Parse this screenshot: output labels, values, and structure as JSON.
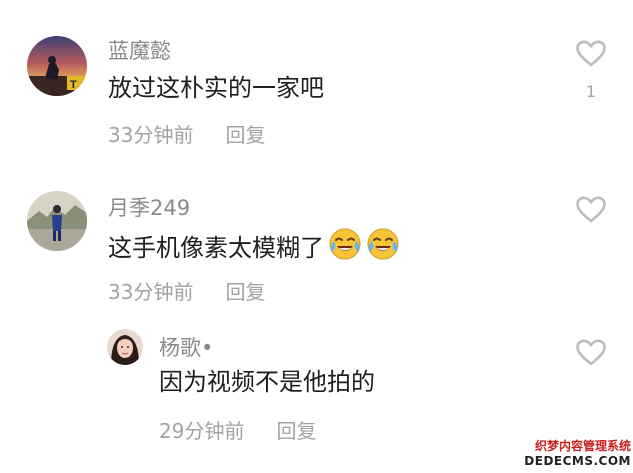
{
  "comments": [
    {
      "username": "蓝魔懿",
      "text": "放过这朴实的一家吧",
      "time": "33分钟前",
      "reply_label": "回复",
      "like_count": "1",
      "avatar": "sunset-photo-avatar"
    },
    {
      "username": "月季249",
      "text": "这手机像素太模糊了",
      "emojis": [
        "crying-laughing-emoji",
        "crying-laughing-emoji"
      ],
      "time": "33分钟前",
      "reply_label": "回复",
      "like_count": "",
      "avatar": "person-outdoor-avatar"
    }
  ],
  "reply": {
    "username": "杨歌•",
    "text": "因为视频不是他拍的",
    "time": "29分钟前",
    "reply_label": "回复",
    "like_count": "",
    "avatar": "woman-portrait-avatar"
  },
  "watermark": {
    "line1": "织梦内容管理系统",
    "line2": "DEDECMS.COM"
  },
  "colors": {
    "username": "#8a8a8a",
    "text": "#1f1f1f",
    "meta": "#a3a3a3",
    "heart": "#bdbdbd"
  }
}
